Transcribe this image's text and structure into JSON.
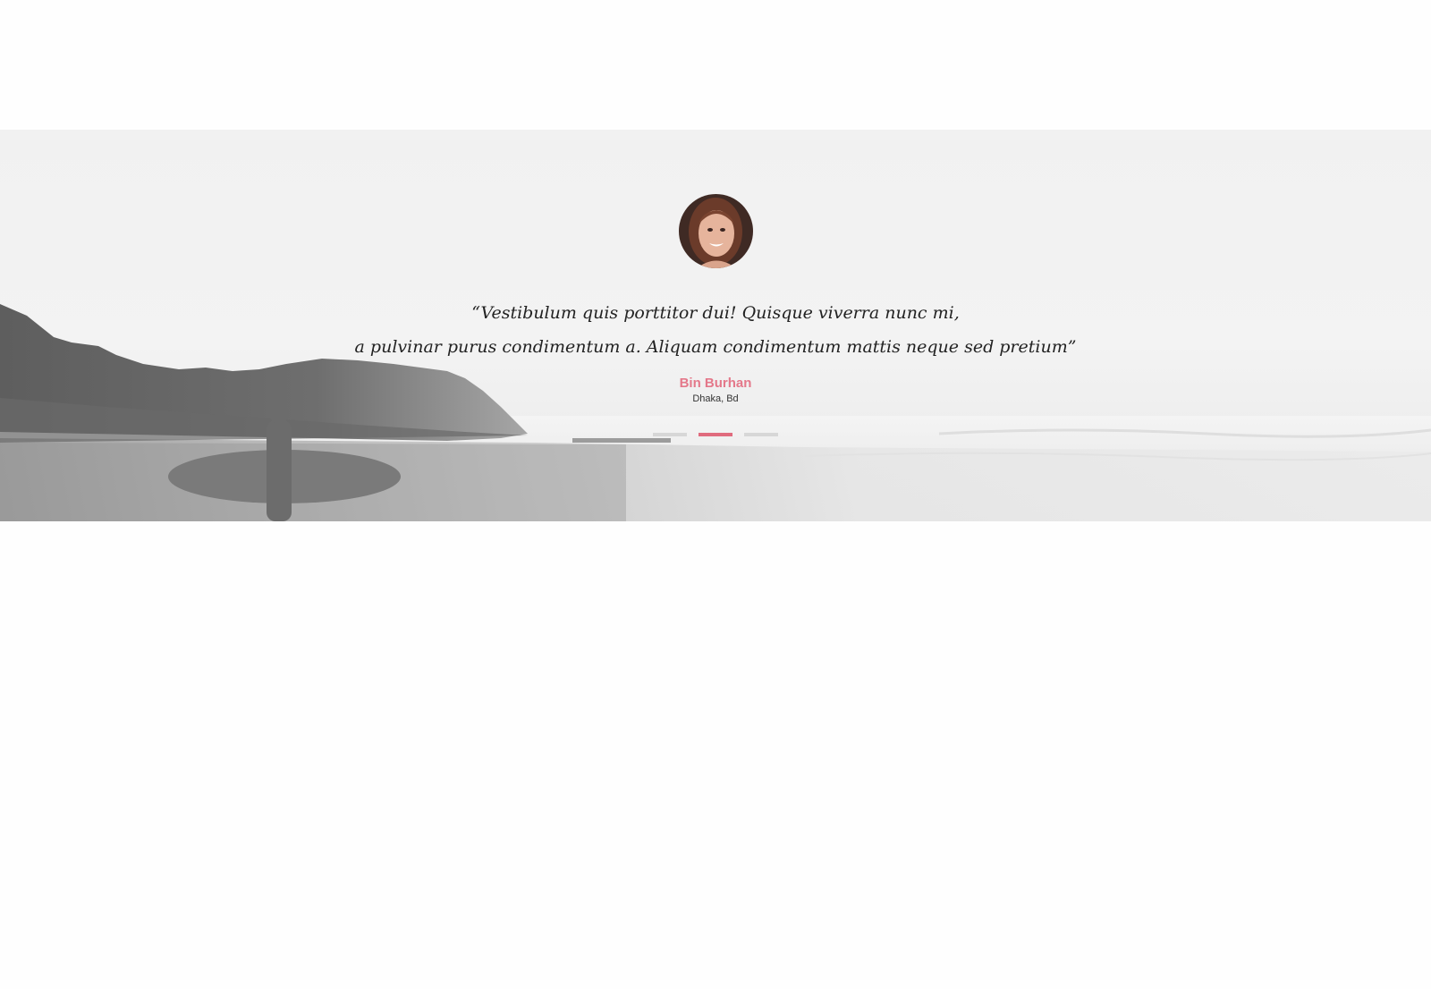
{
  "testimonial": {
    "quote_line_1": "“Vestibulum quis porttitor dui! Quisque viverra nunc mi,",
    "quote_line_2": "a pulvinar purus condimentum a. Aliquam condimentum mattis neque sed pretium”",
    "author_name": "Bin Burhan",
    "author_location": "Dhaka, Bd",
    "accent_color": "#e4788a",
    "avatar_icon": "portrait-photo-icon",
    "background_icon": "beach-surfer-photo"
  },
  "slider": {
    "slide_count": 3,
    "active_index": 1
  }
}
